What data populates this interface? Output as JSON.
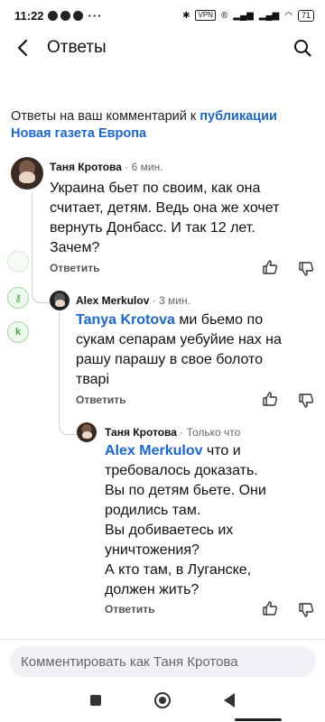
{
  "statusbar": {
    "time": "11:22",
    "dots": "···",
    "vpn": "VPN",
    "battery": "71"
  },
  "header": {
    "title": "Ответы"
  },
  "intro": {
    "text": "Ответы на ваш комментарий к ",
    "link1": "публикации",
    "link2": "Новая газета Европа"
  },
  "comments": [
    {
      "author": "Таня Кротова",
      "time": "· 6 мин.",
      "mention": "",
      "lines": [
        "Украина бьет по своим, как она",
        "считает, детям. Ведь она же хочет",
        "вернуть Донбасс. И так 12 лет.",
        "Зачем?"
      ],
      "reply": "Ответить"
    },
    {
      "author": "Alex Merkulov",
      "time": "· 3 мин.",
      "mention": "Tanya Krotova",
      "lines": [
        " ми бьемо по",
        "сукам сепарам уебуйие нах на",
        "рашу парашу в свое болото",
        "тварі"
      ],
      "reply": "Ответить"
    },
    {
      "author": "Таня Кротова",
      "time": "· Только что",
      "mention": "Alex Merkulov",
      "lines": [
        " что и",
        "требовалось доказать.",
        "Вы по детям бьете. Они",
        "родились там.",
        "Вы добиваетесь их",
        "уничтожения?",
        "А кто там, в Луганске,",
        "должен жить?"
      ],
      "reply": "Ответить"
    }
  ],
  "composer": {
    "placeholder": "Комментировать как Таня Кротова"
  },
  "edge_icons": [
    "k"
  ]
}
